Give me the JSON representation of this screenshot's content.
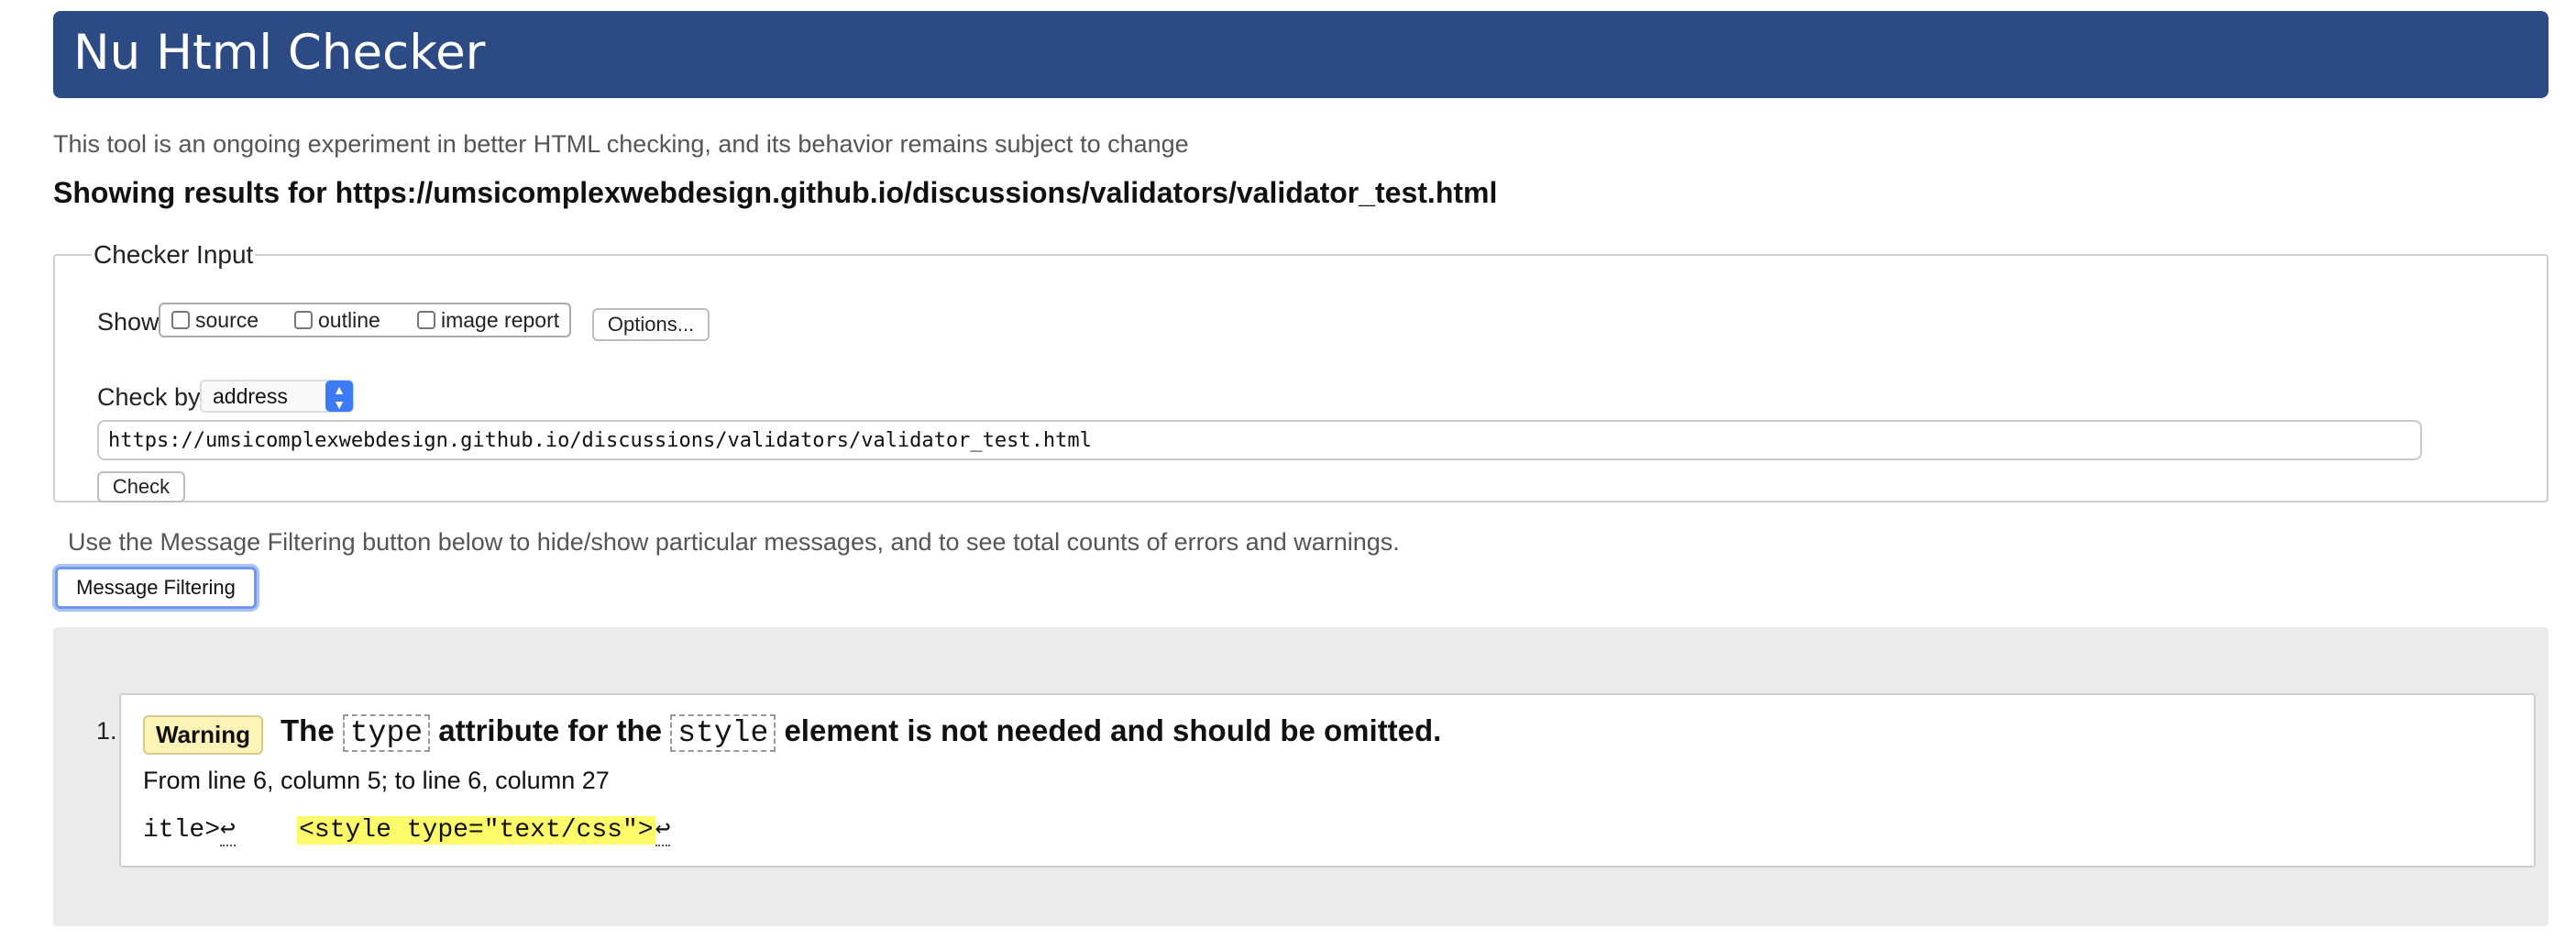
{
  "header": {
    "title": "Nu Html Checker"
  },
  "tagline": "This tool is an ongoing experiment in better HTML checking, and its behavior remains subject to change",
  "results_heading": "Showing results for https://umsicomplexwebdesign.github.io/discussions/validators/validator_test.html",
  "checker_input": {
    "legend": "Checker Input",
    "show_label": "Show",
    "show_options": [
      {
        "label": "source",
        "checked": false
      },
      {
        "label": "outline",
        "checked": false
      },
      {
        "label": "image report",
        "checked": false
      }
    ],
    "options_button": "Options...",
    "check_by_label": "Check by",
    "check_by_value": "address",
    "url_value": "https://umsicomplexwebdesign.github.io/discussions/validators/validator_test.html",
    "check_button": "Check"
  },
  "filter_note": "Use the Message Filtering button below to hide/show particular messages, and to see total counts of errors and warnings.",
  "filter_button": "Message Filtering",
  "messages": [
    {
      "number": "1.",
      "badge": "Warning",
      "text_1": "The",
      "code_1": "type",
      "text_2": "attribute for the",
      "code_2": "style",
      "text_3": "element is not needed and should be omitted.",
      "location": "From line 6, column 5; to line 6, column 27",
      "extract_before": "itle>",
      "extract_return_1": "↩",
      "extract_gap": "    ",
      "extract_highlight": "<style type=\"text/css\">",
      "extract_return_2": "↩"
    }
  ],
  "colors": {
    "header_bg": "#2c4b84",
    "warning_badge_bg": "#fdf3b7",
    "highlight_bg": "#fdfa6a",
    "results_panel_bg": "#ebebeb",
    "focus_ring": "#6f98ec",
    "select_arrow_bg": "#3b7bf6"
  }
}
